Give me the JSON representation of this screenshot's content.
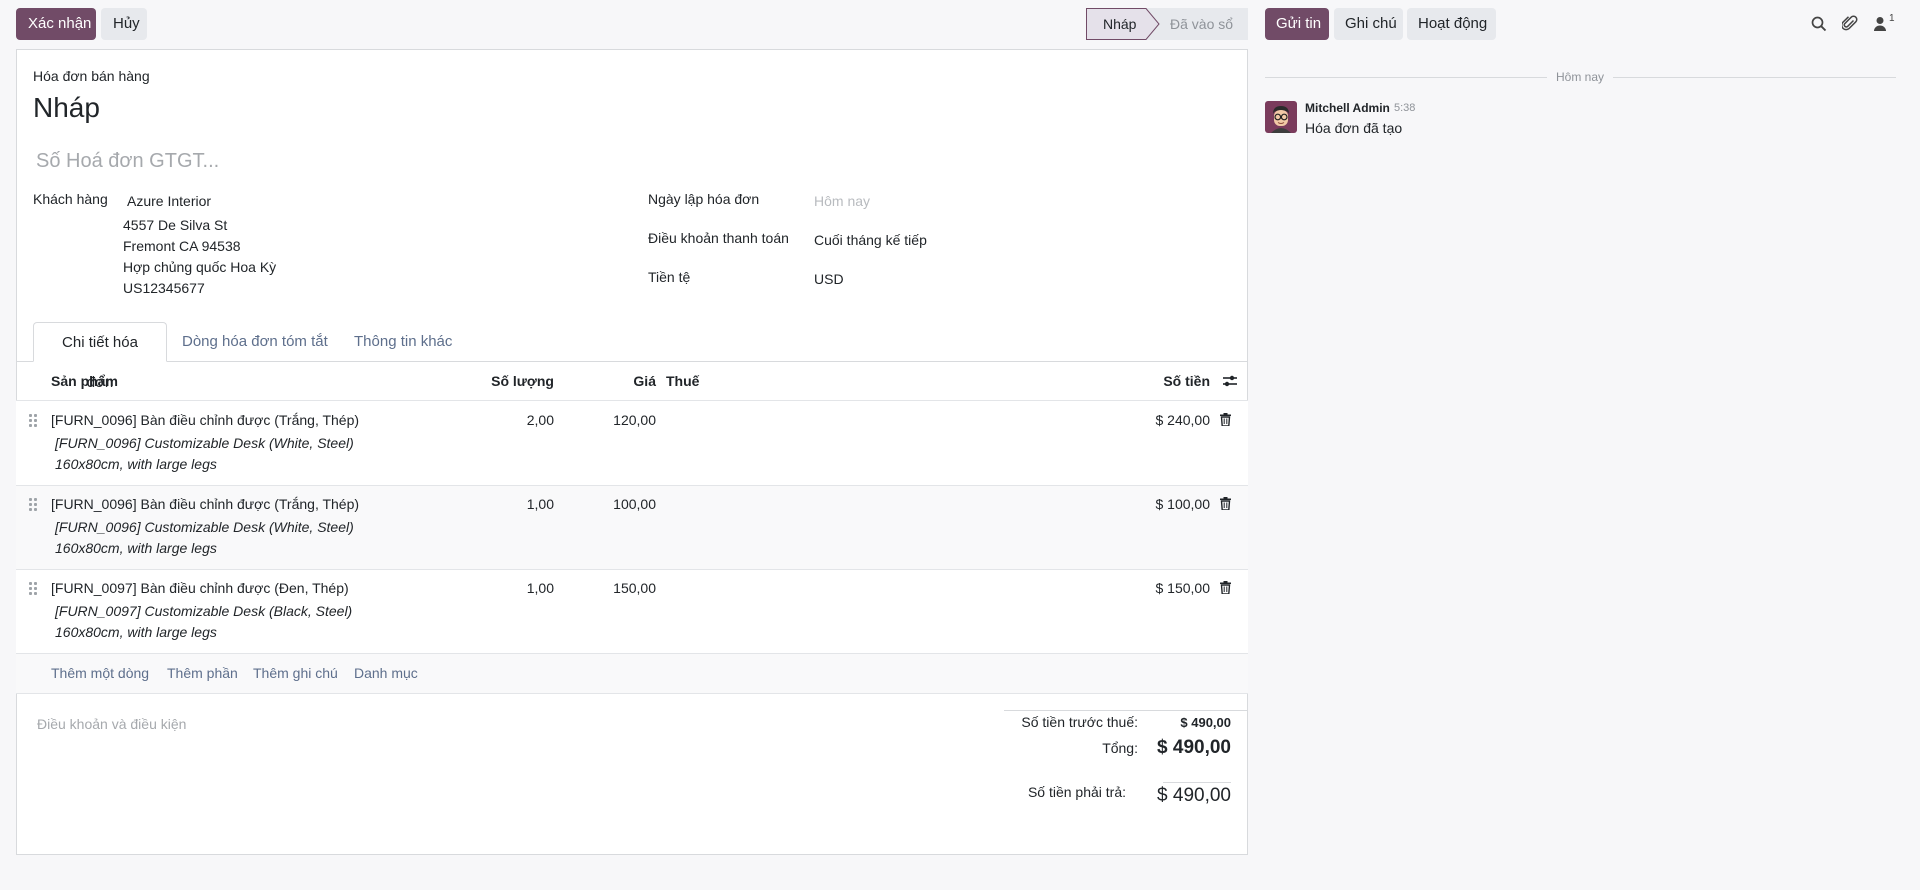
{
  "control_panel": {
    "confirm_label": "Xác nhận",
    "cancel_label": "Hủy"
  },
  "statusbar": {
    "draft": "Nháp",
    "posted": "Đã vào sổ"
  },
  "form": {
    "move_type": "Hóa đơn bán hàng",
    "name": "Nháp",
    "vat_invoice_placeholder": "Số Hoá đơn GTGT...",
    "customer_label": "Khách hàng",
    "customer_name": "Azure Interior",
    "customer_address": [
      "4557 De Silva St",
      "Fremont CA 94538",
      "Hợp chủng quốc Hoa Kỳ",
      "US12345677"
    ],
    "invoice_date_label": "Ngày lập hóa đơn",
    "invoice_date_placeholder": "Hôm nay",
    "payment_terms_label": "Điều khoản thanh toán",
    "payment_terms_value": "Cuối tháng kế tiếp",
    "currency_label": "Tiền tệ",
    "currency_value": "USD"
  },
  "tabs": [
    "Chi tiết hóa đơn",
    "Dòng hóa đơn tóm tắt",
    "Thông tin khác"
  ],
  "table": {
    "headers": {
      "product": "Sản phẩm",
      "quantity": "Số lượng",
      "price": "Giá",
      "tax": "Thuế",
      "amount": "Số tiền"
    },
    "rows": [
      {
        "product": "[FURN_0096] Bàn điều chỉnh được (Trắng, Thép)",
        "desc1": "[FURN_0096] Customizable Desk (White, Steel)",
        "desc2": "160x80cm, with large legs",
        "quantity": "2,00",
        "price": "120,00",
        "amount": "$ 240,00"
      },
      {
        "product": "[FURN_0096] Bàn điều chỉnh được (Trắng, Thép)",
        "desc1": "[FURN_0096] Customizable Desk (White, Steel)",
        "desc2": "160x80cm, with large legs",
        "quantity": "1,00",
        "price": "100,00",
        "amount": "$ 100,00"
      },
      {
        "product": "[FURN_0097] Bàn điều chỉnh được (Đen, Thép)",
        "desc1": "[FURN_0097] Customizable Desk (Black, Steel)",
        "desc2": "160x80cm, with large legs",
        "quantity": "1,00",
        "price": "150,00",
        "amount": "$ 150,00"
      }
    ],
    "add_links": [
      "Thêm một dòng",
      "Thêm phần",
      "Thêm ghi chú",
      "Danh mục"
    ]
  },
  "terms_placeholder": "Điều khoản và điều kiện",
  "totals": {
    "untaxed_label": "Số tiền trước thuế:",
    "untaxed_value": "$ 490,00",
    "total_label": "Tổng:",
    "total_value": "$ 490,00",
    "due_label": "Số tiền phải trả:",
    "due_value": "$ 490,00"
  },
  "chatter": {
    "send_message": "Gửi tin",
    "log_note": "Ghi chú",
    "activities": "Hoạt động",
    "follower_count": "1",
    "date_separator": "Hôm nay",
    "message": {
      "author": "Mitchell Admin",
      "time": "5:38",
      "body": "Hóa đơn đã tạo"
    }
  },
  "colors": {
    "primary": "#714b67",
    "secondary": "#e7e9ed",
    "link": "#5e6f8c"
  }
}
